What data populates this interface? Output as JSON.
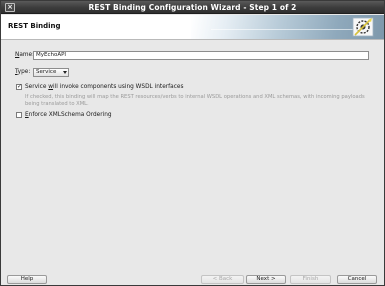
{
  "window": {
    "title": "REST Binding Configuration Wizard - Step 1 of 2",
    "close_glyph": "×"
  },
  "header": {
    "title": "REST Binding",
    "logo_icon": "wizard-gear-icon"
  },
  "form": {
    "name_label_u": "N",
    "name_label_rest": "ame:",
    "name_value": "MyEchoAPI",
    "type_label_u": "T",
    "type_label_rest": "ype:",
    "type_value": "Service",
    "wsdl_checkbox_pre": "Service ",
    "wsdl_checkbox_u": "w",
    "wsdl_checkbox_post": "ill invoke components using WSDL interfaces",
    "wsdl_checked": true,
    "wsdl_help": "If checked, this binding will map the REST resources/verbs to internal WSDL operations and XML schemas, with incoming payloads being translated to XML.",
    "xmlschema_checkbox_u": "E",
    "xmlschema_checkbox_rest": "nforce XMLSchema Ordering",
    "xmlschema_checked": false
  },
  "buttons": {
    "help": "Help",
    "back": "< Back",
    "next": "Next >",
    "finish": "Finish",
    "cancel": "Cancel"
  },
  "colors": {
    "titlebar": "#3c3c3c",
    "dialog_bg": "#e8e8e8",
    "banner_accent": "#8fa9bc"
  }
}
